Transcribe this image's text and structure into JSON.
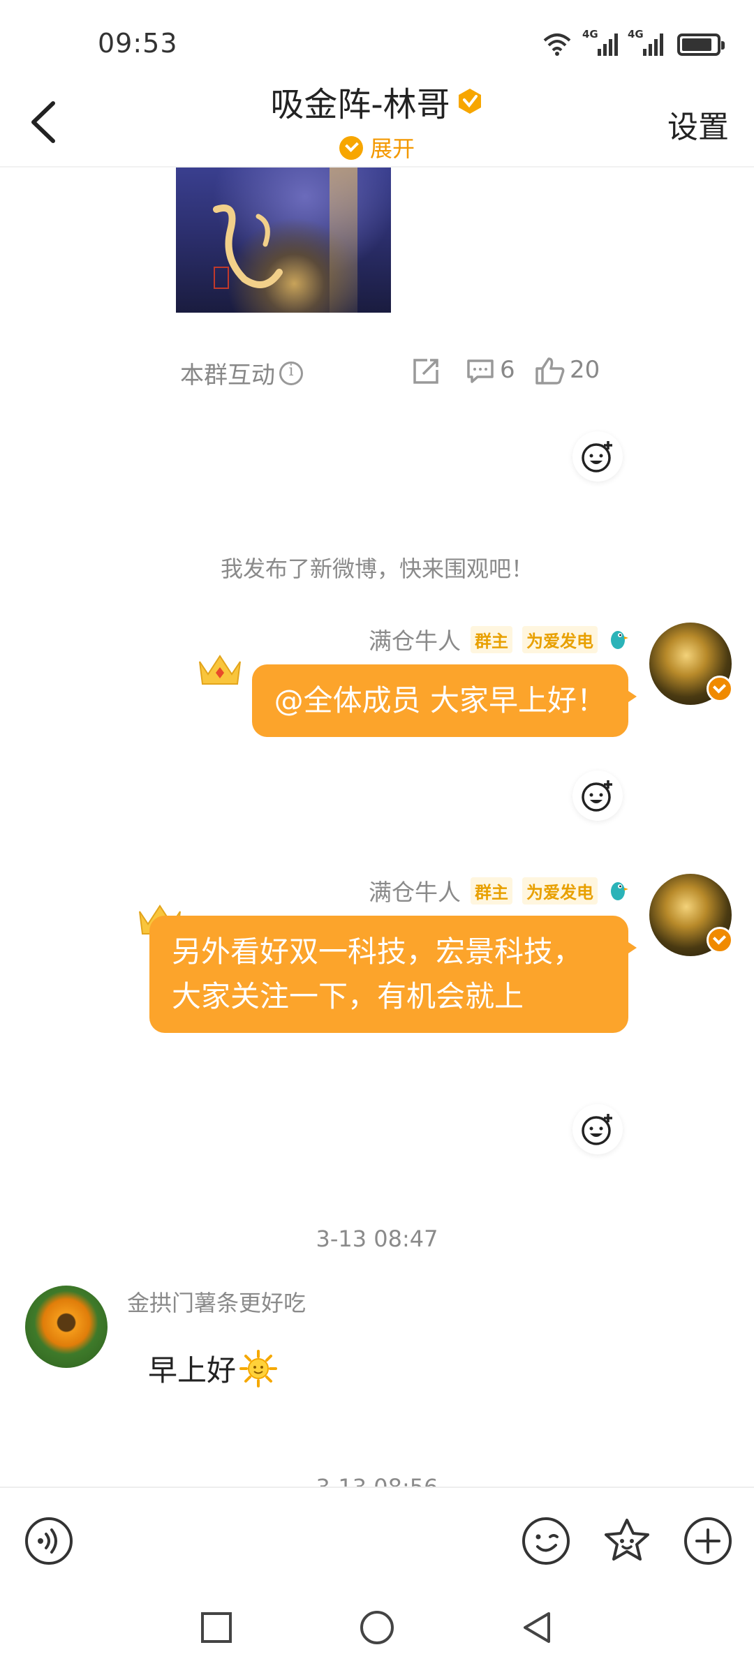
{
  "status_bar": {
    "time": "09:53",
    "signal1_tag": "4G",
    "signal2_tag": "4G"
  },
  "header": {
    "title": "吸金阵-林哥",
    "expand_label": "展开",
    "settings_label": "设置"
  },
  "post": {
    "interaction_label": "本群互动",
    "comment_count": "6",
    "like_count": "20"
  },
  "system_notice": "我发布了新微博，快来围观吧！",
  "messages": [
    {
      "sender": "满仓牛人",
      "tag_owner": "群主",
      "tag_fan": "为爱发电",
      "text": "@全体成员 大家早上好！"
    },
    {
      "sender": "满仓牛人",
      "tag_owner": "群主",
      "tag_fan": "为爱发电",
      "text": "另外看好双一科技，宏景科技，大家关注一下，有机会就上"
    }
  ],
  "timestamp1": "3-13 08:47",
  "left_message": {
    "sender": "金拱门薯条更好吃",
    "text": "早上好"
  },
  "timestamp2_partial": "3-13 08:56",
  "icons": {
    "back": "back-arrow-icon",
    "voice": "voice-icon",
    "emoji": "emoji-icon",
    "sticker": "sticker-icon",
    "plus": "plus-icon"
  },
  "colors": {
    "accent": "#fca42b",
    "badge": "#f39800"
  }
}
